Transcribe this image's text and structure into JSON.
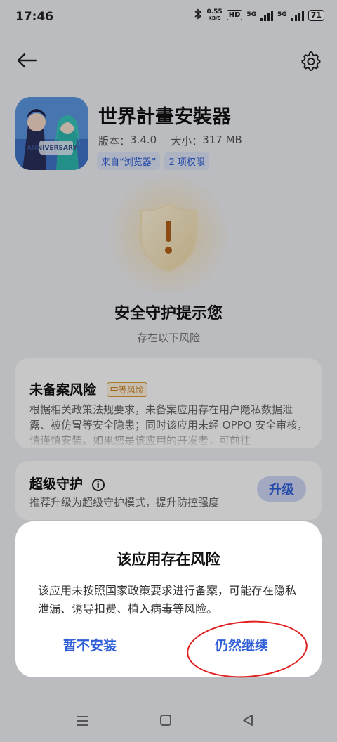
{
  "status_bar": {
    "time": "17:46",
    "net_speed_value": "0.55",
    "net_speed_unit": "KB/S",
    "hd_label": "HD",
    "sim1_label": "5G",
    "sim2_label": "5G",
    "battery": "71"
  },
  "header": {
    "back_icon": "arrow-left-icon",
    "settings_icon": "gear-icon"
  },
  "app": {
    "name": "世界計畫安裝器",
    "version_label": "版本：",
    "version": "3.4.0",
    "size_label": "大小：",
    "size": "317 MB",
    "icon_text": "ANNIVERSARY",
    "tags": [
      "来自“浏览器”",
      "2 项权限"
    ]
  },
  "security": {
    "title": "安全守护提示您",
    "subtitle": "存在以下风险"
  },
  "risk_card": {
    "title": "未备案风险",
    "badge": "中等风险",
    "description": "根据相关政策法规要求，未备案应用存在用户隐私数据泄露、被仿冒等安全隐患；同时该应用未经 OPPO 安全审核，请谨慎安装。如果您是该应用的开发者，可前往"
  },
  "protect_card": {
    "title": "超级守护",
    "description": "推荐升级为超级守护模式，提升防控强度",
    "button": "升级"
  },
  "dialog": {
    "title": "该应用存在风险",
    "body": "该应用未按照国家政策要求进行备案，可能存在隐私泄漏、诱导扣费、植入病毒等风险。",
    "cancel": "暂不安装",
    "continue": "仍然继续"
  },
  "colors": {
    "accent": "#2f5ed8",
    "warning": "#c87a14",
    "annotation": "#e02020"
  }
}
